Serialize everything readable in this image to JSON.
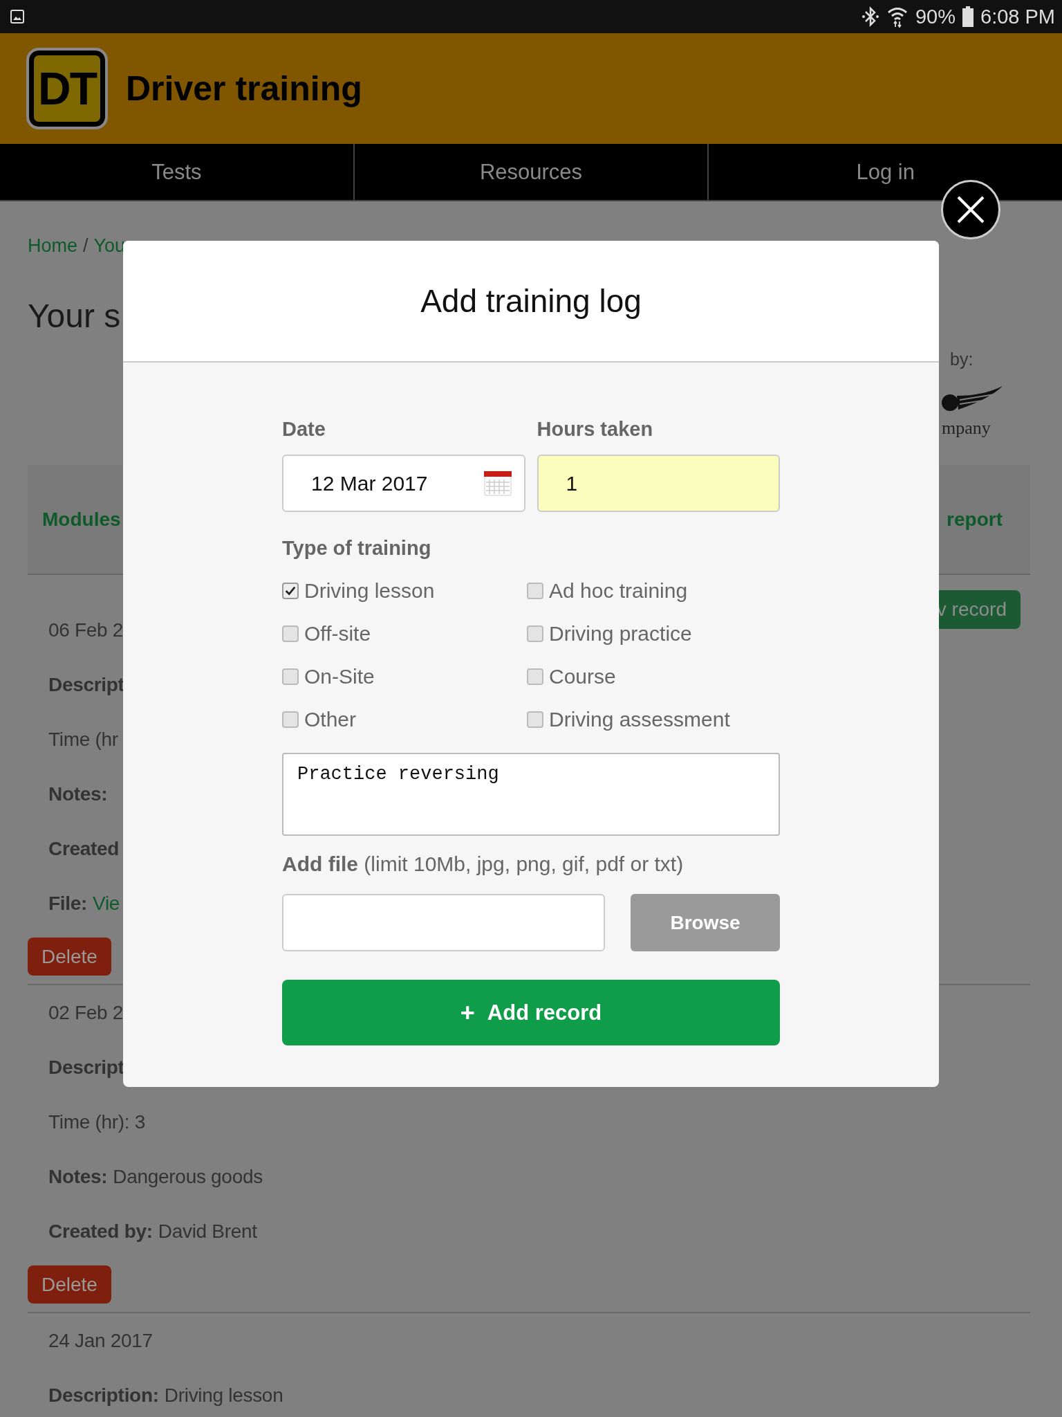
{
  "status_bar": {
    "battery": "90%",
    "time": "6:08 PM"
  },
  "header": {
    "logo": "DT",
    "title": "Driver training"
  },
  "nav": [
    {
      "label": "Tests"
    },
    {
      "label": "Resources"
    },
    {
      "label": "Log in"
    }
  ],
  "background_page": {
    "breadcrumb": {
      "home": "Home",
      "separator": "/",
      "current": "You"
    },
    "heading": "Your s",
    "sponsor_label": "by:",
    "sponsor_logo_text": "mpany",
    "tabs": [
      {
        "label": "Modules"
      },
      {
        "label": "report"
      }
    ],
    "new_record_button": "v record",
    "records": [
      {
        "lines": [
          {
            "kind": "plain",
            "text": "06 Feb 2"
          },
          {
            "kind": "plain",
            "text": "**Descript**"
          },
          {
            "kind": "plain",
            "text": "Time (hr"
          },
          {
            "kind": "plain",
            "text": "**Notes:**"
          },
          {
            "kind": "plain",
            "text": "**Created**"
          },
          {
            "kind": "file",
            "label": "File:",
            "link": "Vie"
          }
        ],
        "delete": "Delete"
      },
      {
        "lines": [
          {
            "kind": "plain",
            "text": "02 Feb 2"
          },
          {
            "kind": "plain",
            "text": "**Descript**"
          },
          {
            "kind": "plain",
            "text": "Time (hr): 3"
          },
          {
            "kind": "plain",
            "text": "**Notes:** Dangerous goods"
          },
          {
            "kind": "plain",
            "text": "**Created by:** David Brent"
          }
        ],
        "delete": "Delete"
      },
      {
        "lines": [
          {
            "kind": "plain",
            "text": "24 Jan 2017"
          },
          {
            "kind": "plain",
            "text": "**Description:** Driving lesson"
          }
        ]
      }
    ]
  },
  "modal": {
    "title": "Add training log",
    "date": {
      "label": "Date",
      "value": "12 Mar 2017"
    },
    "hours": {
      "label": "Hours taken",
      "value": "1",
      "highlighted": true
    },
    "training_type": {
      "label": "Type of training",
      "options": [
        {
          "label": "Driving lesson",
          "checked": true
        },
        {
          "label": "Ad hoc training",
          "checked": false
        },
        {
          "label": "Off-site",
          "checked": false
        },
        {
          "label": "Driving practice",
          "checked": false
        },
        {
          "label": "On-Site",
          "checked": false
        },
        {
          "label": "Course",
          "checked": false
        },
        {
          "label": "Other",
          "checked": false
        },
        {
          "label": "Driving assessment",
          "checked": false
        }
      ]
    },
    "notes": {
      "value": "Practice reversing"
    },
    "file": {
      "label": "**Add file** (limit 10Mb, jpg, png, gif, pdf or txt)",
      "browse": "Browse"
    },
    "submit": {
      "icon": "+",
      "label": "Add record"
    }
  }
}
